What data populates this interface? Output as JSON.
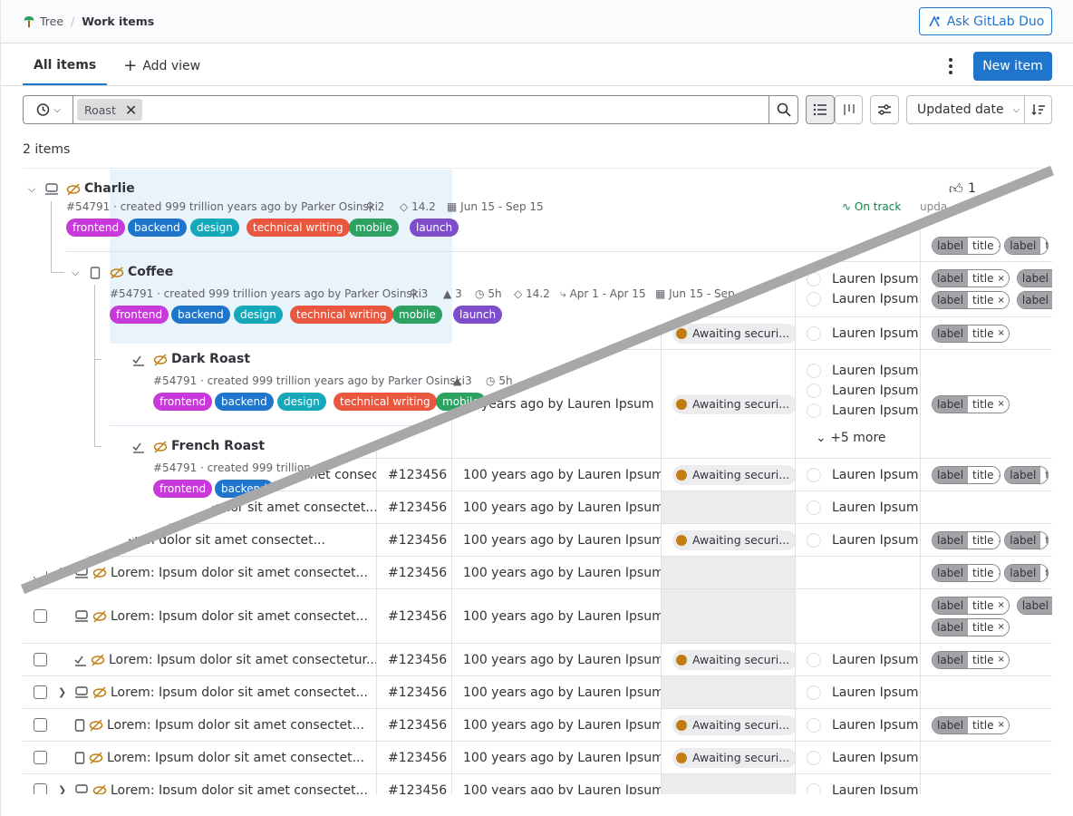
{
  "breadcrumb": {
    "project": "Tree",
    "current": "Work items"
  },
  "header": {
    "duo_button": "Ask GitLab Duo"
  },
  "tabs": {
    "active": "All items",
    "add_view": "Add view",
    "new_item": "New item"
  },
  "filter": {
    "token": "Roast",
    "sort_label": "Updated date"
  },
  "count_text": "2 items",
  "tree": {
    "charlie": {
      "title": "Charlie",
      "meta": "#54791 · created 999 trillion years ago by Parker Osinski",
      "children": "2",
      "weight": "14.2",
      "dates": "Jun 15 - Sep 15",
      "status": "On track",
      "updated": "upda",
      "thumbs": "1"
    },
    "coffee": {
      "title": "Coffee",
      "meta": "#54791 · created 999 trillion years ago by Parker Osinski",
      "children": "3",
      "blocked": "3",
      "time": "5h",
      "weight": "14.2",
      "milestone": "Apr 1 - Apr 15",
      "dates": "Jun 15 - Sep"
    },
    "dark": {
      "title": "Dark Roast",
      "meta": "#54791 · created 999 trillion years ago by Parker Osinski",
      "blocked": "3",
      "time": "5h"
    },
    "french": {
      "title": "French Roast",
      "meta": "#54791 · created 999 trillion ye"
    },
    "labels": [
      "frontend",
      "backend",
      "design",
      "technical writing",
      "mobile",
      "launch"
    ],
    "label_colors": [
      "#c73ad9",
      "#1f75cb",
      "#14a8b8",
      "#e9573f",
      "#2da160",
      "#7e4dc9"
    ]
  },
  "grid": {
    "title": "Lorem: Ipsum dolor sit amet consectet...",
    "title_full": "Lorem: Ipsum dolor sit amet consectetur...",
    "title_partial": "dolor sit amet consectet...",
    "title_partial2": "sum dolor sit amet consectet...",
    "title_partial3": "r sit amet consectet...",
    "id": "#123456",
    "updated": "100 years ago by Lauren Ipsum",
    "status": "Awaiting securi...",
    "assignee": "Lauren Ipsum",
    "more": "+5 more",
    "label_key": "label",
    "label_val": "title",
    "label_x": "×",
    "label_key_cut": "label",
    "label_val_cut": "t",
    "status_top": "Awaiting securi...",
    "partial_updated": "years ago by Lauren Ipsum"
  }
}
